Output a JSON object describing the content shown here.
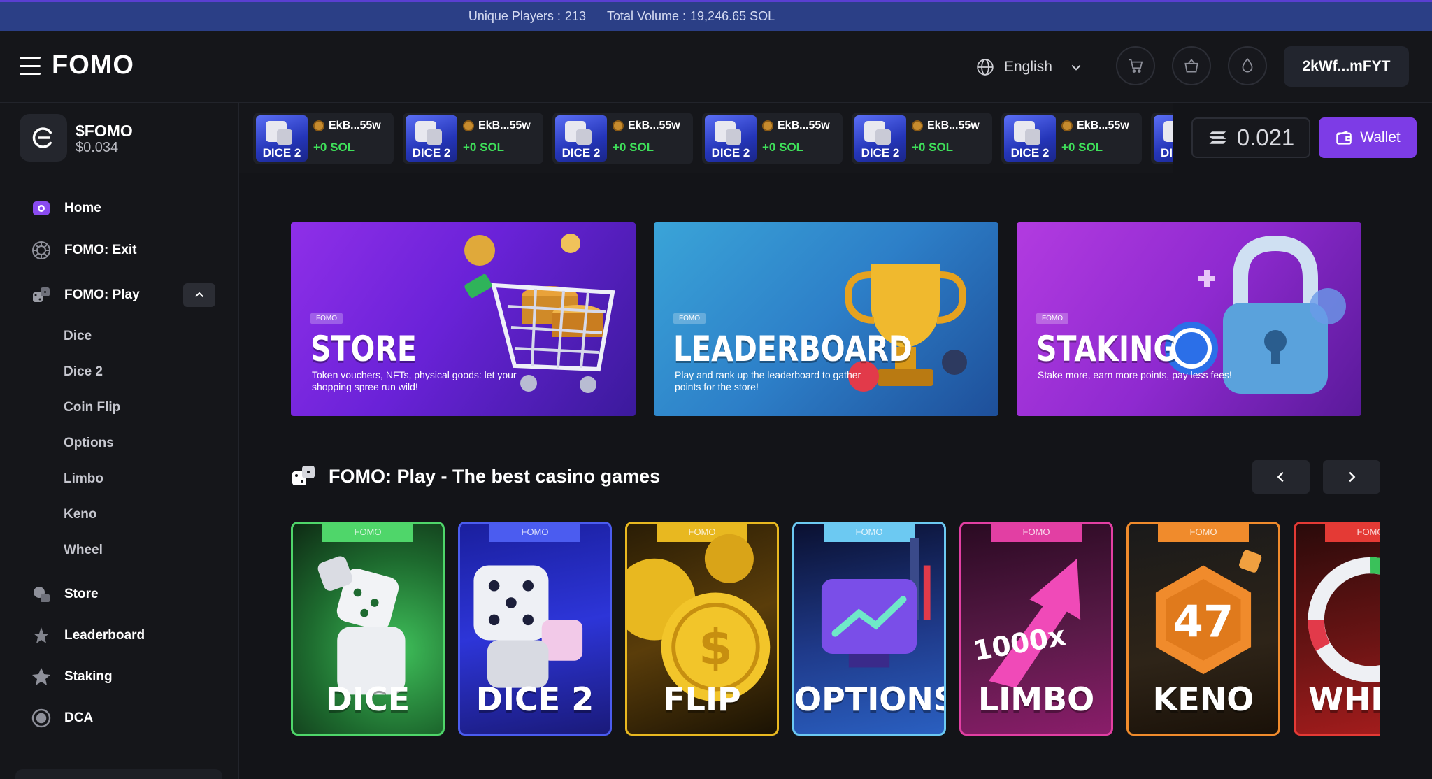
{
  "stats": {
    "players_label": "Unique Players :",
    "players_value": "213",
    "volume_label": "Total Volume :",
    "volume_value": "19,246.65 SOL"
  },
  "header": {
    "brand": "FOMO",
    "language": "English",
    "address": "2kWf...mFYT",
    "icons": [
      "cart-icon",
      "bag-icon",
      "drop-icon"
    ]
  },
  "token": {
    "name": "$FOMO",
    "price": "$0.034"
  },
  "ticker": {
    "items": [
      {
        "game": "DICE 2",
        "user": "EkB...55w",
        "amount": "+0 SOL"
      },
      {
        "game": "DICE 2",
        "user": "EkB...55w",
        "amount": "+0 SOL"
      },
      {
        "game": "DICE 2",
        "user": "EkB...55w",
        "amount": "+0 SOL"
      },
      {
        "game": "DICE 2",
        "user": "EkB...55w",
        "amount": "+0 SOL"
      },
      {
        "game": "DICE 2",
        "user": "EkB...55w",
        "amount": "+0 SOL"
      },
      {
        "game": "DICE 2",
        "user": "EkB...55w",
        "amount": "+0 SOL"
      },
      {
        "game": "DI",
        "user": "",
        "amount": ""
      }
    ]
  },
  "balance": {
    "value": "0.021",
    "wallet_label": "Wallet"
  },
  "sidebar": {
    "items": [
      {
        "label": "Home",
        "icon": "home-icon"
      },
      {
        "label": "FOMO: Exit",
        "icon": "exit-icon"
      },
      {
        "label": "FOMO: Play",
        "icon": "dice-icon"
      },
      {
        "label": "Store",
        "icon": "store-icon"
      },
      {
        "label": "Leaderboard",
        "icon": "trophy-icon"
      },
      {
        "label": "Staking",
        "icon": "star-icon"
      },
      {
        "label": "DCA",
        "icon": "dca-icon"
      }
    ],
    "play_sub": [
      "Dice",
      "Dice 2",
      "Coin Flip",
      "Options",
      "Limbo",
      "Keno",
      "Wheel"
    ]
  },
  "banners": [
    {
      "tag": "FOMO",
      "title": "STORE",
      "desc": "Token vouchers, NFTs, physical goods: let your shopping spree run wild!"
    },
    {
      "tag": "FOMO",
      "title": "LEADERBOARD",
      "desc": "Play and rank up the leaderboard to gather points for the store!"
    },
    {
      "tag": "FOMO",
      "title": "STAKING",
      "desc": "Stake more, earn more points, pay less fees!"
    }
  ],
  "section": {
    "title": "FOMO: Play - The best casino games"
  },
  "games": [
    {
      "tag": "FOMO",
      "name": "DICE",
      "color": "#4fd66a"
    },
    {
      "tag": "FOMO",
      "name": "DICE 2",
      "color": "#4b5cf0"
    },
    {
      "tag": "FOMO",
      "name": "FLIP",
      "color": "#e8b820"
    },
    {
      "tag": "FOMO",
      "name": "OPTIONS",
      "color": "#6cc9f2"
    },
    {
      "tag": "FOMO",
      "name": "LIMBO",
      "color": "#e23fa3"
    },
    {
      "tag": "FOMO",
      "name": "KENO",
      "color": "#f08b2c"
    },
    {
      "tag": "FOMO",
      "name": "WHE",
      "color": "#e43a35"
    }
  ],
  "colors": {
    "accent": "#7d3ce6",
    "stats_bar": "#2b3f86",
    "win_green": "#3fe05a"
  }
}
